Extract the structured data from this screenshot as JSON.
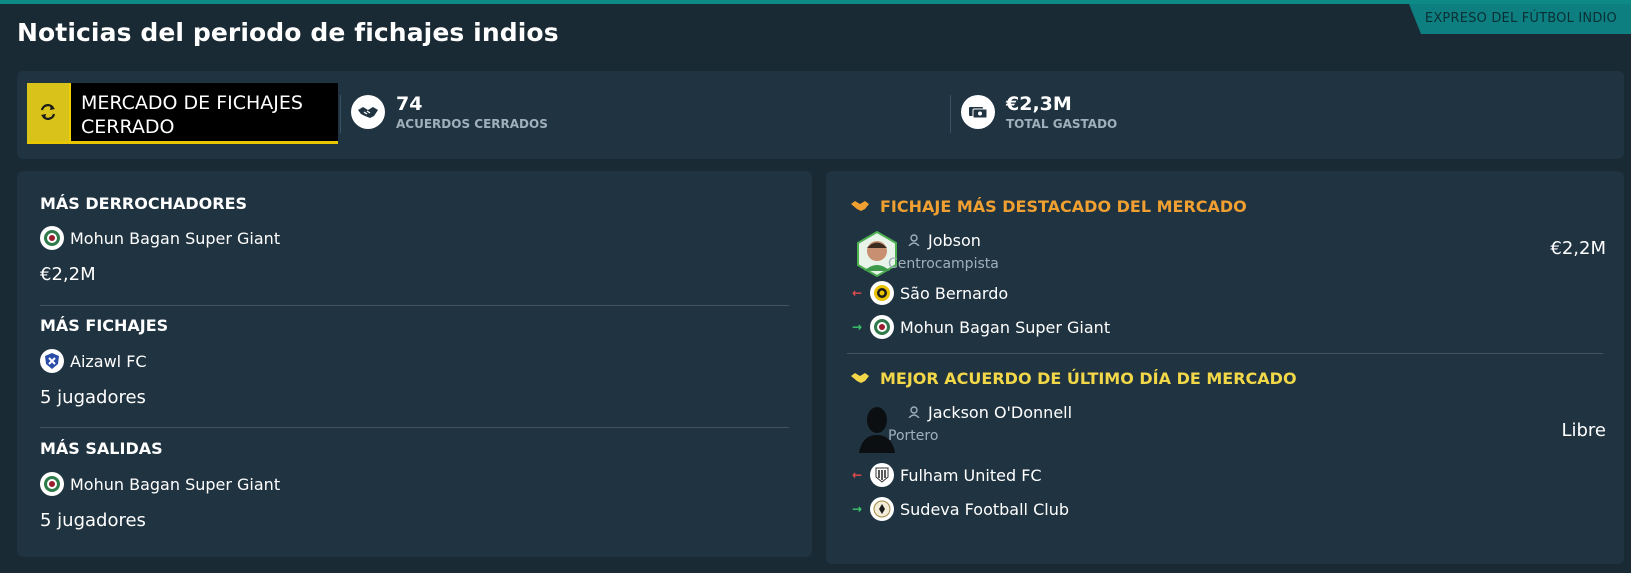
{
  "header": {
    "title": "Noticias del periodo de fichajes indios",
    "tag": "EXPRESO DEL FÚTBOL INDIO"
  },
  "summary": {
    "market_status_line1": "MERCADO DE FICHAJES",
    "market_status_line2": "CERRADO",
    "deals_value": "74",
    "deals_label": "ACUERDOS CERRADOS",
    "spent_value": "€2,3M",
    "spent_label": "TOTAL GASTADO"
  },
  "left_panel": {
    "spenders": {
      "heading": "MÁS DERROCHADORES",
      "club": "Mohun Bagan Super Giant",
      "value": "€2,2M"
    },
    "signings": {
      "heading": "MÁS FICHAJES",
      "club": "Aizawl FC",
      "value": "5 jugadores"
    },
    "departures": {
      "heading": "MÁS SALIDAS",
      "club": "Mohun Bagan Super Giant",
      "value": "5 jugadores"
    }
  },
  "right_panel": {
    "top_signing": {
      "heading": "FICHAJE MÁS DESTACADO DEL MERCADO",
      "player": "Jobson",
      "position": "Centrocampista",
      "fee": "€2,2M",
      "from_club": "São Bernardo",
      "to_club": "Mohun Bagan Super Giant"
    },
    "deadline_deal": {
      "heading": "MEJOR ACUERDO DE ÚLTIMO DÍA DE MERCADO",
      "player": "Jackson O'Donnell",
      "position": "Portero",
      "fee": "Libre",
      "from_club": "Fulham United FC",
      "to_club": "Sudeva Football Club"
    }
  },
  "colors": {
    "background": "#1a2a34",
    "panel": "#203340",
    "accent_teal": "#0e8a86",
    "market_yellow": "#d9c21a",
    "heading_orange": "#f0a030",
    "heading_yellow": "#f2d848",
    "arrow_out": "#e34b4b",
    "arrow_in": "#3bc96b"
  },
  "icons": [
    "refresh-icon",
    "handshake-icon",
    "money-icon",
    "person-icon",
    "arrow-left-icon",
    "arrow-right-icon",
    "club-crest-icon"
  ]
}
